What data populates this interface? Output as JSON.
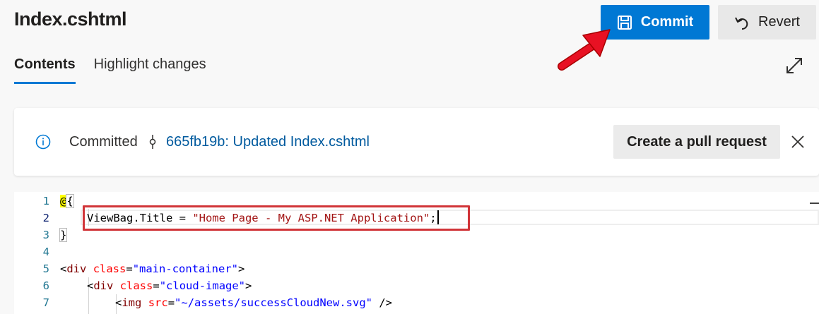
{
  "header": {
    "file_name": "Index.cshtml",
    "commit_label": "Commit",
    "revert_label": "Revert"
  },
  "tabs": [
    {
      "label": "Contents",
      "active": true
    },
    {
      "label": "Highlight changes",
      "active": false
    }
  ],
  "banner": {
    "status_label": "Committed",
    "commit_link": "665fb19b: Updated Index.cshtml",
    "pr_button_label": "Create a pull request"
  },
  "editor": {
    "line_numbers": [
      "1",
      "2",
      "3",
      "4",
      "5",
      "6",
      "7"
    ],
    "current_line": 2,
    "line1": {
      "at": "@",
      "brace": "{"
    },
    "line2": {
      "code": "ViewBag.Title = ",
      "string": "\"Home Page - My ASP.NET Application\"",
      "end": ";"
    },
    "line3": {
      "brace": "}"
    },
    "line5": {
      "lt": "<",
      "tag": "div",
      "attr": "class",
      "eq": "=",
      "val": "\"main-container\"",
      "gt": ">"
    },
    "line6": {
      "lt": "<",
      "tag": "div",
      "attr": "class",
      "eq": "=",
      "val": "\"cloud-image\"",
      "gt": ">"
    },
    "line7": {
      "lt": "<",
      "tag": "img",
      "attr": "src",
      "eq": "=",
      "val": "\"~/assets/successCloudNew.svg\"",
      "gt": " />"
    }
  },
  "colors": {
    "accent": "#0078d4",
    "link": "#005a9e",
    "highlight_box": "#d13438",
    "annotation_arrow": "#e81123"
  },
  "icons": [
    "save-icon",
    "undo-icon",
    "expand-icon",
    "info-icon",
    "commit-icon",
    "close-icon",
    "annotation-arrow-icon"
  ]
}
